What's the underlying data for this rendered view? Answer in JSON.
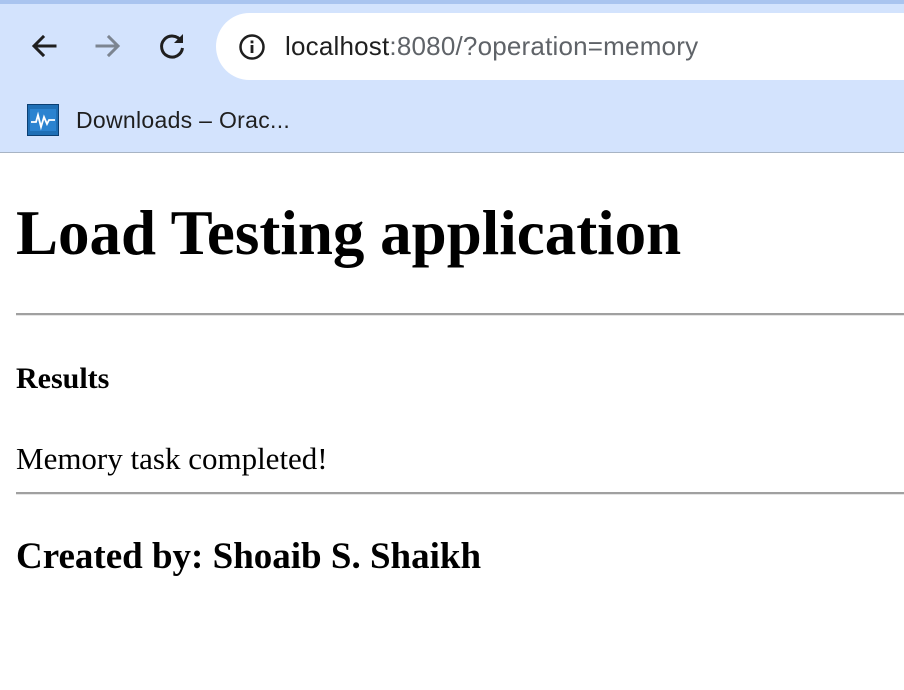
{
  "browser": {
    "url_host": "localhost",
    "url_rest": ":8080/?operation=memory",
    "back_icon": "arrow-left-icon",
    "forward_icon": "arrow-right-icon",
    "reload_icon": "reload-icon",
    "info_icon": "info-icon",
    "bookmarks": [
      {
        "label": "Downloads – Orac...",
        "icon": "oracle-favicon-icon"
      }
    ],
    "colors": {
      "chrome_background": "#d3e3fd",
      "address_bar": "#ffffff"
    }
  },
  "page": {
    "title": "Load Testing application",
    "results_heading": "Results",
    "result_message": "Memory task completed!",
    "creator_line": "Created by: Shoaib S. Shaikh"
  }
}
